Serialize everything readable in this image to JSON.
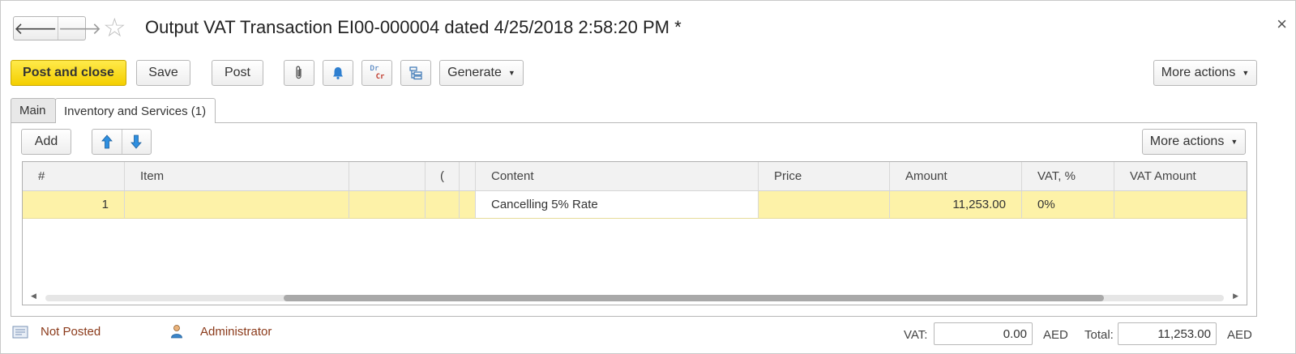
{
  "header": {
    "title": "Output VAT Transaction EI00-000004 dated 4/25/2018 2:58:20 PM *",
    "back_icon": "arrow-left-icon",
    "forward_icon": "arrow-right-icon",
    "back_glyph": "🡐",
    "forward_glyph": "🡒",
    "star_glyph": "☆",
    "close_glyph": "×"
  },
  "toolbar": {
    "post_and_close": "Post and close",
    "save": "Save",
    "post": "Post",
    "generate": "Generate",
    "more_actions": "More actions",
    "dr": "Dr",
    "cr": "Cr",
    "accent": "#f4cf00"
  },
  "tabs": [
    {
      "label": "Main",
      "active": false
    },
    {
      "label": "Inventory and Services (1)",
      "active": true
    }
  ],
  "table_toolbar": {
    "add": "Add",
    "more_actions": "More actions"
  },
  "table": {
    "columns": [
      "#",
      "Item",
      "",
      "(",
      "",
      "Content",
      "Price",
      "Amount",
      "VAT, %",
      "VAT Amount"
    ],
    "rows": [
      {
        "num": "1",
        "item": "",
        "c2": "",
        "c3": "",
        "c4": "",
        "content": "Cancelling 5% Rate",
        "price": "",
        "amount": "11,253.00",
        "vat_pct": "0%",
        "vat_amount": ""
      }
    ]
  },
  "footer": {
    "status": "Not Posted",
    "user": "Administrator",
    "vat_label": "VAT:",
    "vat_value": "0.00",
    "vat_currency": "AED",
    "total_label": "Total:",
    "total_value": "11,253.00",
    "total_currency": "AED"
  }
}
